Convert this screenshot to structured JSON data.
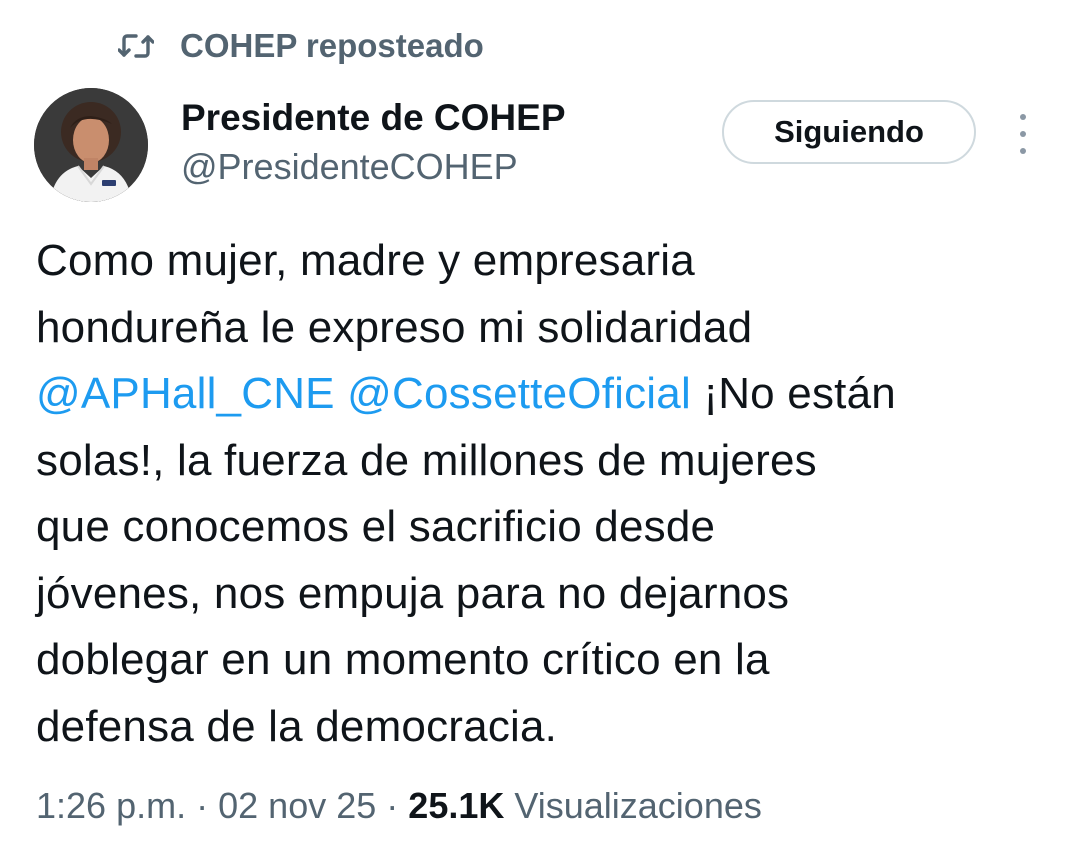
{
  "repost": {
    "text": "COHEP reposteado",
    "icon": "repost-icon"
  },
  "author": {
    "name": "Presidente de COHEP",
    "handle": "@PresidenteCOHEP",
    "avatar_icon": "avatar-photo"
  },
  "follow_button": {
    "label": "Siguiendo"
  },
  "more_menu": {
    "icon": "more-vertical-icon"
  },
  "tweet": {
    "lines": [
      {
        "text": "Como mujer, madre y empresaria"
      },
      {
        "text": "hondureña le expreso mi solidaridad"
      },
      {
        "mention1": "@APHall_CNE",
        "mention2": "@CossetteOficial",
        "text": "¡No están"
      },
      {
        "text": "solas!, la fuerza de millones de mujeres"
      },
      {
        "text": "que conocemos el sacrificio desde"
      },
      {
        "text": "jóvenes, nos empuja para no dejarnos"
      },
      {
        "text": "doblegar en un momento crítico en la"
      },
      {
        "text": "defensa de la democracia."
      }
    ]
  },
  "meta": {
    "time": "1:26 p.m.",
    "sep": "·",
    "date": "02 nov 25",
    "views_count": "25.1K",
    "views_label": "Visualizaciones"
  },
  "colors": {
    "mention": "#1d9bf0",
    "secondary_text": "#536471",
    "primary_text": "#0f1419",
    "button_border": "#cfd9de"
  }
}
